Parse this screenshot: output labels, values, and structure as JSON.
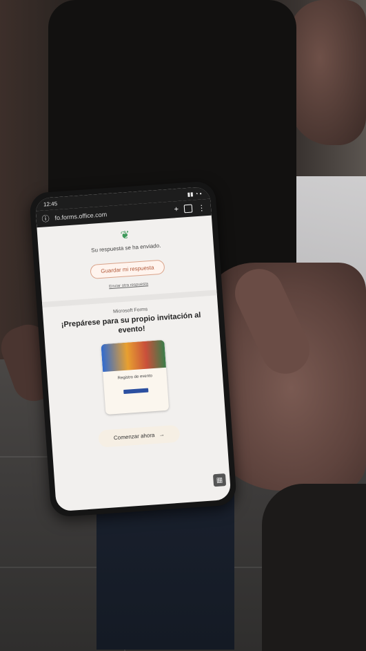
{
  "phone": {
    "status": {
      "time": "12:45",
      "indicators": "▮▮ ◔ ▪"
    },
    "browser": {
      "url": "fo.forms.office.com",
      "icons": {
        "info": "info-icon",
        "new_tab": "plus-icon",
        "tabs": "tabs-icon",
        "menu": "more-vertical-icon"
      },
      "new_tab_glyph": "+",
      "tabs_count": "",
      "menu_glyph": "⋮",
      "info_glyph": "ⓘ"
    },
    "page": {
      "logo_icon": "sprout-icon",
      "title": "Su respuesta se ha enviado.",
      "subtitle": "",
      "save_button": "Guardar mi respuesta",
      "another_link": "Enviar otra respuesta",
      "brand": "Microsoft Forms",
      "headline": "¡Prepárese para su propio invitación al evento!",
      "card": {
        "title": "Registro de evento"
      },
      "cta_button": "Comenzar ahora",
      "cta_arrow": "→"
    }
  },
  "colors": {
    "accent": "#b25a3b",
    "card_button": "#2b4fa0"
  }
}
